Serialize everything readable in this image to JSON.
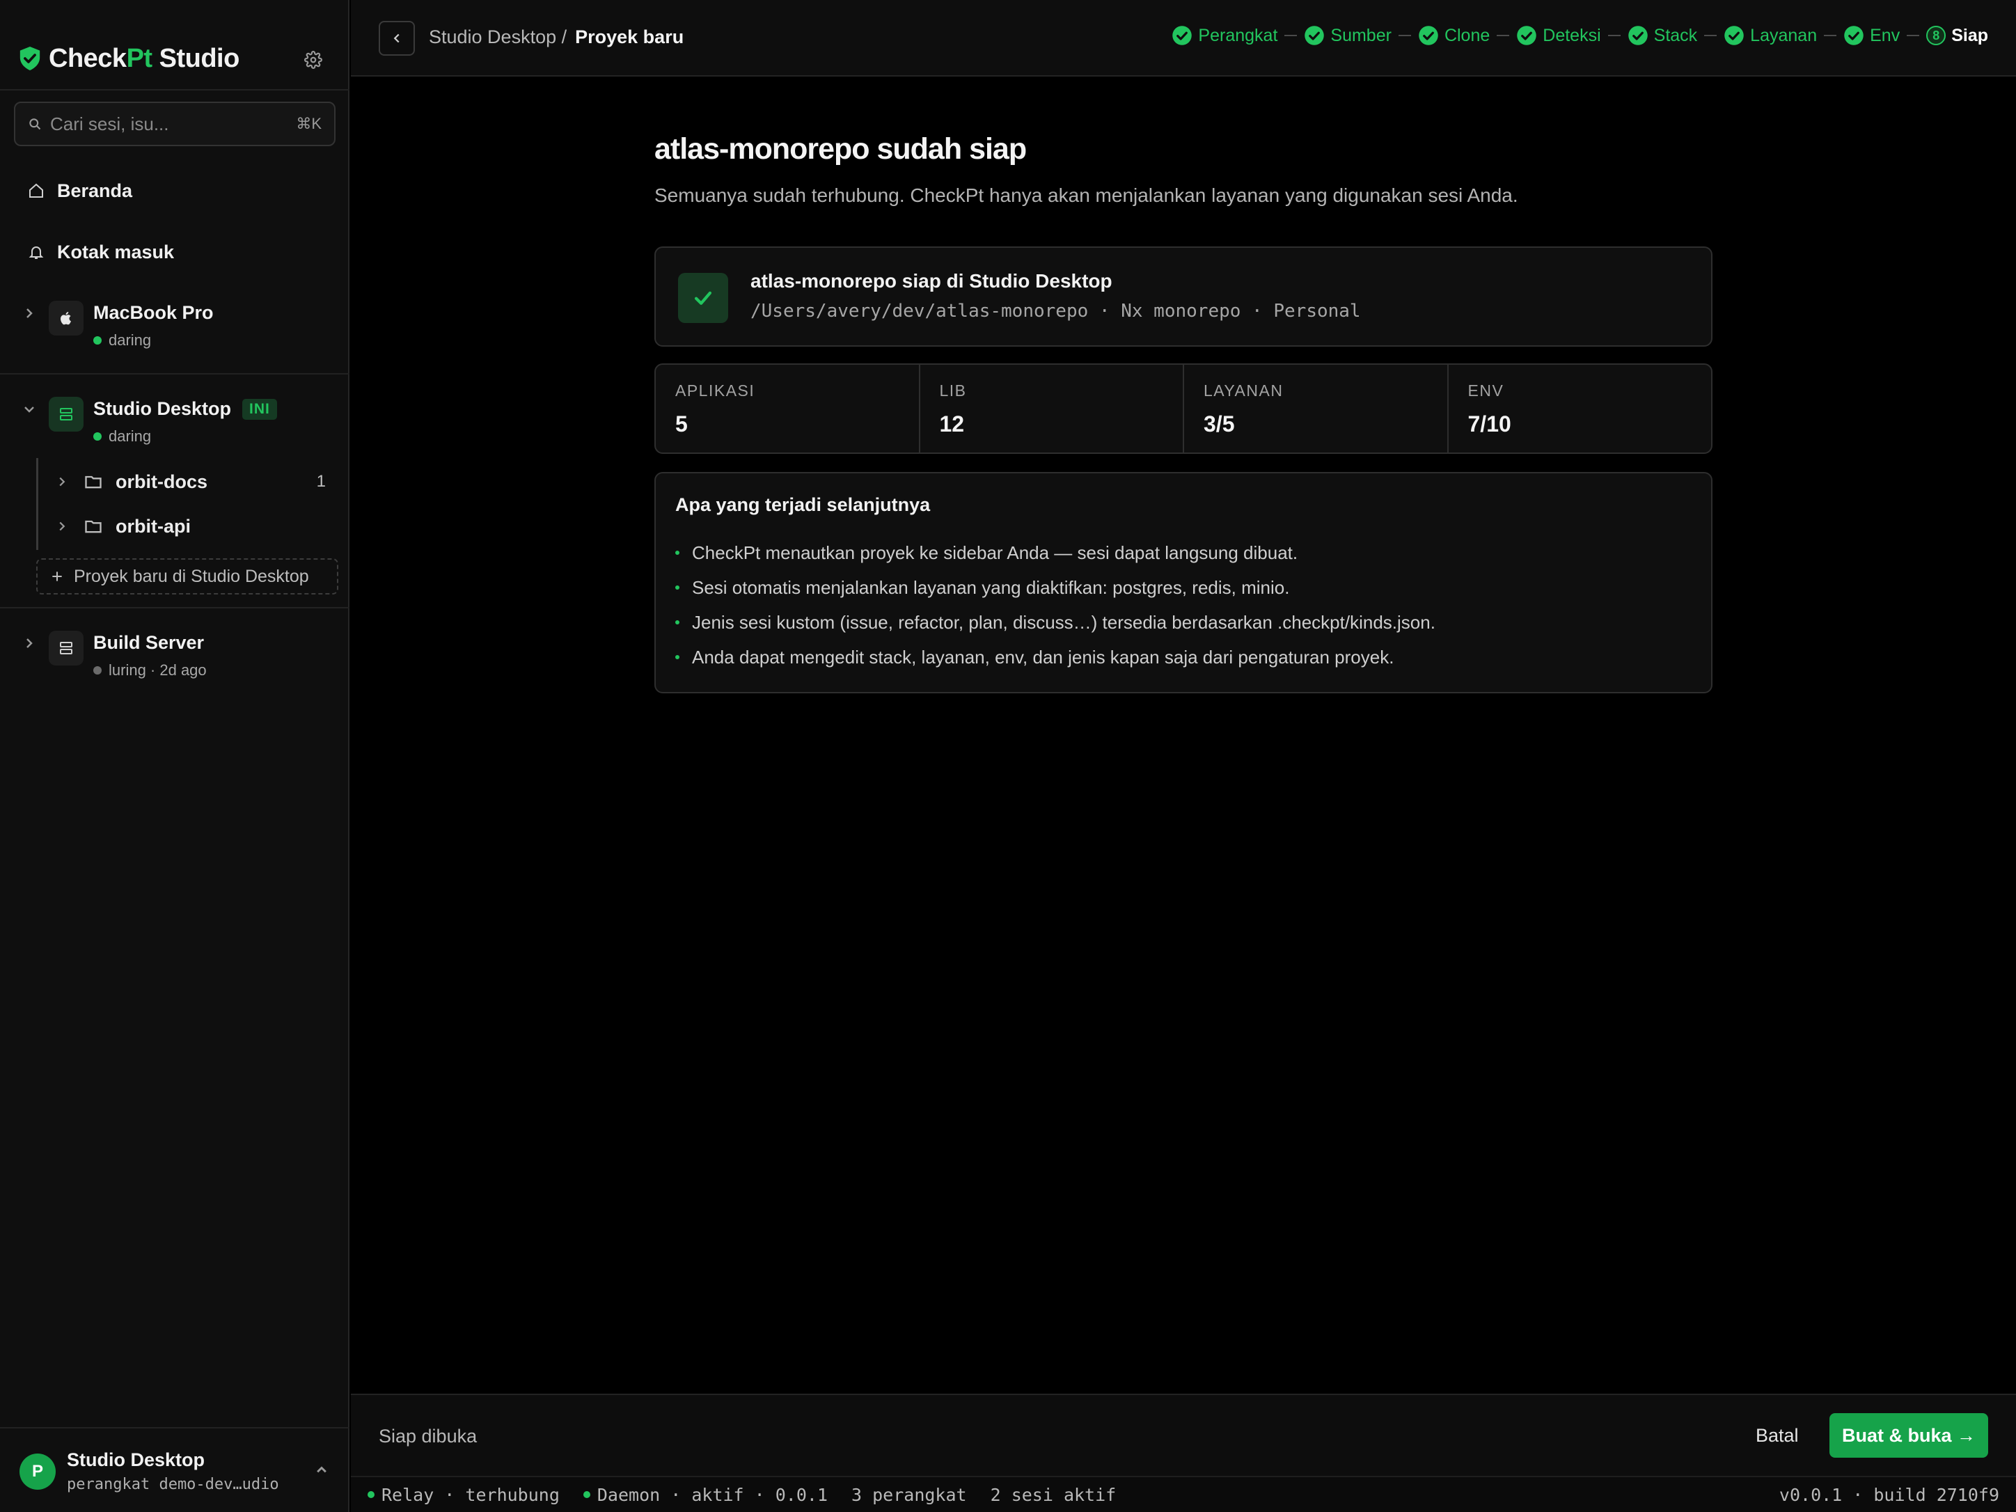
{
  "brand": {
    "check": "Check",
    "pt": "Pt",
    "studio": " Studio"
  },
  "search": {
    "placeholder": "Cari sesi, isu...",
    "shortcut": "⌘K"
  },
  "nav": {
    "home": "Beranda",
    "inbox": "Kotak masuk"
  },
  "devices": [
    {
      "name": "MacBook Pro",
      "status": "daring"
    },
    {
      "name": "Studio Desktop",
      "badge": "INI",
      "status": "daring",
      "projects": [
        {
          "name": "orbit-docs",
          "count": "1"
        },
        {
          "name": "orbit-api",
          "count": ""
        }
      ],
      "new_project": "Proyek baru di Studio Desktop"
    },
    {
      "name": "Build Server",
      "status": "luring · 2d ago"
    }
  ],
  "user": {
    "initial": "P",
    "name": "Studio Desktop",
    "sub": "perangkat demo-dev…udio"
  },
  "breadcrumb": {
    "parent": "Studio Desktop /",
    "current": "Proyek baru"
  },
  "steps": [
    {
      "label": "Perangkat",
      "done": true
    },
    {
      "label": "Sumber",
      "done": true
    },
    {
      "label": "Clone",
      "done": true
    },
    {
      "label": "Deteksi",
      "done": true
    },
    {
      "label": "Stack",
      "done": true
    },
    {
      "label": "Layanan",
      "done": true
    },
    {
      "label": "Env",
      "done": true
    },
    {
      "label": "Siap",
      "number": "8",
      "done": false
    }
  ],
  "page": {
    "title": "atlas-monorepo sudah siap",
    "subtitle": "Semuanya sudah terhubung. CheckPt hanya akan menjalankan layanan yang digunakan sesi Anda."
  },
  "ready": {
    "title": "atlas-monorepo siap di Studio Desktop",
    "meta": "/Users/avery/dev/atlas-monorepo · Nx monorepo · Personal"
  },
  "stats": [
    {
      "label": "APLIKASI",
      "value": "5"
    },
    {
      "label": "LIB",
      "value": "12"
    },
    {
      "label": "LAYANAN",
      "value": "3/5"
    },
    {
      "label": "ENV",
      "value": "7/10"
    }
  ],
  "next": {
    "title": "Apa yang terjadi selanjutnya",
    "items": [
      "CheckPt menautkan proyek ke sidebar Anda — sesi dapat langsung dibuat.",
      "Sesi otomatis menjalankan layanan yang diaktifkan: postgres, redis, minio.",
      "Jenis sesi kustom (issue, refactor, plan, discuss…) tersedia berdasarkan .checkpt/kinds.json.",
      "Anda dapat mengedit stack, layanan, env, dan jenis kapan saja dari pengaturan proyek."
    ]
  },
  "footer": {
    "status": "Siap dibuka",
    "cancel": "Batal",
    "primary": "Buat & buka →"
  },
  "statusbar": {
    "relay": "Relay · terhubung",
    "daemon": "Daemon · aktif · 0.0.1",
    "devices": "3 perangkat",
    "sessions": "2 sesi aktif",
    "version": "v0.0.1 · build 2710f9"
  },
  "colors": {
    "accent": "#22c55e",
    "primary_button": "#16a34a",
    "background": "#000000",
    "sidebar": "#0f0f0f"
  }
}
